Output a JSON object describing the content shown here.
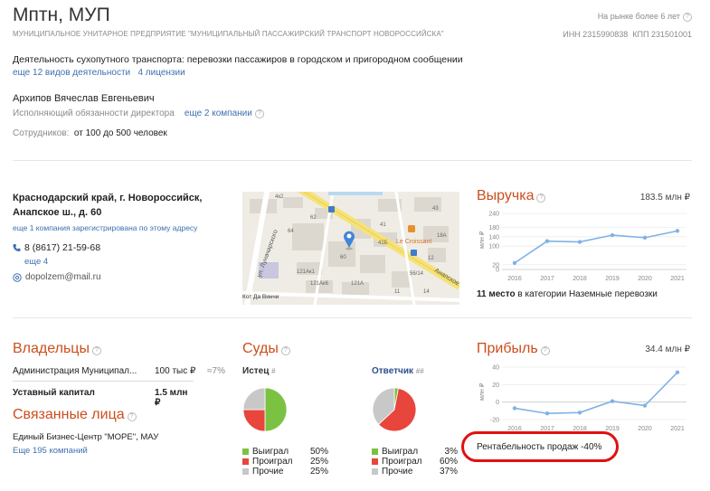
{
  "header": {
    "company_name": "Мптн, МУП",
    "full_name": "МУНИЦИПАЛЬНОЕ УНИТАРНОЕ ПРЕДПРИЯТИЕ \"МУНИЦИПАЛЬНЫЙ ПАССАЖИРСКИЙ ТРАНСПОРТ НОВОРОССИЙСКА\"",
    "market_age": "На рынке более 6 лет",
    "inn": "ИНН 2315990838",
    "kpp": "КПП 231501001"
  },
  "activity": {
    "main": "Деятельность сухопутного транспорта: перевозки пассажиров в городском и пригородном сообщении",
    "more_link": "еще 12 видов деятельности",
    "licenses_link": "4 лицензии"
  },
  "director": {
    "name": "Архипов Вячеслав Евгеньевич",
    "role": "Исполняющий обязанности директора",
    "more_link": "еще 2 компании"
  },
  "staff": {
    "label": "Сотрудников:",
    "value": "от 100 до 500 человек"
  },
  "contacts": {
    "address_line1": "Краснодарский край, г. Новороссийск,",
    "address_line2": "Анапское ш., д. 60",
    "address_note": "еще 1 компания зарегистрирована по этому адресу",
    "phone": "8 (8617) 21-59-68",
    "phone_more": "еще 4",
    "email": "dopolzem@mail.ru"
  },
  "map": {
    "labels": {
      "street_lunacharsky": "ул. Луначарского",
      "anapskoe": "Анапское",
      "le_croissant": "Le Croissant",
      "kot": "Кот Да Винчи",
      "n42": "4к2",
      "n62": "62",
      "n64": "64",
      "n60": "60",
      "n41": "41",
      "n41b": "41Б",
      "n43": "43",
      "n18a": "18А",
      "n12": "12",
      "n121ak1": "121Ак1",
      "n121ak6": "121Ак6",
      "n121a": "121А",
      "n56": "56/14",
      "n11": "11",
      "n14": "14"
    }
  },
  "revenue": {
    "title": "Выручка",
    "value": "183.5 млн ₽",
    "rank_bold": "11 место",
    "rank_rest": "в категории Наземные перевозки"
  },
  "profit": {
    "title": "Прибыль",
    "value": "34.4 млн ₽",
    "profitability": "Рентабельность продаж -40%"
  },
  "owners": {
    "title": "Владельцы",
    "rows": [
      {
        "name": "Администрация Муниципал...",
        "amount": "100 тыс ₽",
        "share": "≈7%"
      }
    ],
    "capital_label": "Уставный капитал",
    "capital_value": "1.5 млн ₽"
  },
  "related": {
    "title": "Связанные лица",
    "item": "Единый Бизнес-Центр \"МОРЕ\", МАУ",
    "more_link": "Еще 195 компаний"
  },
  "courts": {
    "title": "Суды",
    "plaintiff": {
      "label": "Истец",
      "hash": "#",
      "legend": [
        {
          "label": "Выиграл",
          "value": "50%"
        },
        {
          "label": "Проиграл",
          "value": "25%"
        },
        {
          "label": "Прочие",
          "value": "25%"
        }
      ]
    },
    "defendant": {
      "label": "Ответчик",
      "hash": "##",
      "legend": [
        {
          "label": "Выиграл",
          "value": "3%"
        },
        {
          "label": "Проиграл",
          "value": "60%"
        },
        {
          "label": "Прочие",
          "value": "37%"
        }
      ]
    }
  },
  "colors": {
    "accent": "#cc4e1e",
    "link": "#3d6fb0",
    "won": "#7cc242",
    "lost": "#e8453c",
    "other": "#c8c8c8",
    "line": "#7fb2e5",
    "highlight": "#e01010"
  },
  "chart_data": [
    {
      "type": "line",
      "title": "Выручка",
      "ylabel": "млн ₽",
      "x": [
        "2016",
        "2017",
        "2018",
        "2019",
        "2020",
        "2021"
      ],
      "series": [
        {
          "values": [
            28,
            121,
            118,
            147,
            136,
            165
          ]
        }
      ],
      "yticks": [
        0,
        20,
        100,
        140,
        180,
        240
      ],
      "yticks_labels": [
        "0",
        "20",
        "100",
        "140",
        "180",
        "240"
      ],
      "ylim": [
        0,
        240
      ],
      "grid": true
    },
    {
      "type": "line",
      "title": "Прибыль",
      "ylabel": "млн ₽",
      "x": [
        "2016",
        "2017",
        "2018",
        "2019",
        "2020",
        "2021"
      ],
      "series": [
        {
          "values": [
            -7,
            -13,
            -12,
            1,
            -4,
            34
          ]
        }
      ],
      "yticks": [
        -20,
        0,
        20,
        40
      ],
      "ylim": [
        -20,
        40
      ],
      "grid": true
    },
    {
      "type": "pie",
      "title": "Истец",
      "categories": [
        "Выиграл",
        "Проиграл",
        "Прочие"
      ],
      "values": [
        50,
        25,
        25
      ]
    },
    {
      "type": "pie",
      "title": "Ответчик",
      "categories": [
        "Выиграл",
        "Проиграл",
        "Прочие"
      ],
      "values": [
        3,
        60,
        37
      ]
    }
  ]
}
